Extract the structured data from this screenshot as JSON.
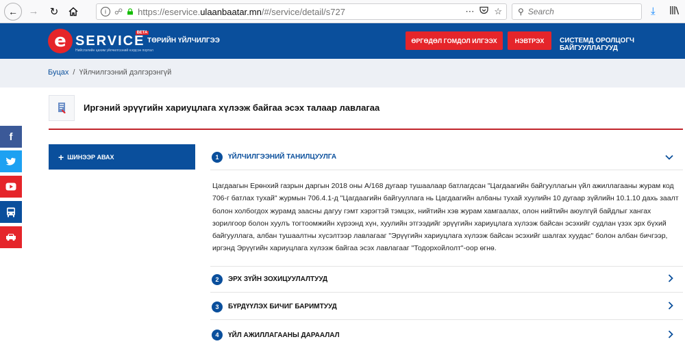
{
  "browser": {
    "url_prefix": "https://eservice.",
    "url_domain": "ulaanbaatar.mn",
    "url_suffix": "/#/service/detail/s727",
    "search_placeholder": "Search"
  },
  "header": {
    "logo_letter": "e",
    "logo_word": "SERVICE",
    "logo_beta": "BETA",
    "logo_tagline": "Нийслэлийн цахим үйлчилгээний нэгдсэн портал",
    "nav_public": "ТӨРИЙН ҮЙЛЧИЛГЭЭ",
    "complaint_button": "ӨРГӨДӨЛ ГОМДОЛ ИЛГЭЭХ",
    "login_button": "НЭВТРЭХ",
    "nav_connect": "СИСТЕМД ОРОЛЦОГЧ БАЙГУУЛЛАГУУД",
    "brand_color": "#0a4f9c",
    "accent_color": "#e5252a"
  },
  "breadcrumb": {
    "back": "Буцах",
    "separator": "/",
    "current": "Үйлчилгээний дэлгэрэнгүй"
  },
  "page": {
    "title": "Иргэний эрүүгийн хариуцлага хүлээж байгаа эсэх талаар лавлагаа",
    "subscribe_button": "ШИНЭЭР АВАХ"
  },
  "social": {
    "items": [
      "facebook-icon",
      "twitter-icon",
      "youtube-icon",
      "bus-icon",
      "car-icon"
    ]
  },
  "sections": [
    {
      "number": "1",
      "label": "ҮЙЛЧИЛГЭЭНИЙ ТАНИЛЦУУЛГА",
      "expanded": true
    },
    {
      "number": "2",
      "label": "ЭРХ ЗҮЙН ЗОХИЦУУЛАЛТУУД",
      "expanded": false
    },
    {
      "number": "3",
      "label": "БҮРДҮҮЛЭХ БИЧИГ БАРИМТУУД",
      "expanded": false
    },
    {
      "number": "4",
      "label": "ҮЙЛ АЖИЛЛАГААНЫ ДАРААЛАЛ",
      "expanded": false
    }
  ],
  "intro_text": "Цагдаагын Ерөнхий газрын даргын 2018 оны А/168 дугаар  тушаалаар батлагдсан \"Цагдаагийн байгууллагын үйл ажиллагааны журам код 706-г батлах тухай\" журмын 706.4.1-д \"Цагдаагийн байгууллага нь Цагдаагийн албаны тухай хуулийн 10 дугаар зүйлийн 10.1.10 дахь заалт болон холбогдох журамд заасны дагуу гэмт хэрэгтэй тэмцэх, нийтийн хэв журам хамгаалах, олон нийтийн аюулгүй байдлыг хангах зорилгоор болон хуулъ тогтоомжийн хүрээнд хүн, хуулийн этгээдийг эрүүгийн хариуцлага хүлээж байсан эсэхийг судлан үзэх эрх бүхий байгууллага, албан тушаалтны хүсэлтээр лавлагааг \"Эрүүгийн хариуцлага хүлээж байсан эсэхийг шалгах хуудас\" болон албан бичгээр, иргэнд Эрүүгийн хариуцлага хүлээж байгаа эсэх лавлагааг \"Тодорхойлолт\"-оор өгнө."
}
